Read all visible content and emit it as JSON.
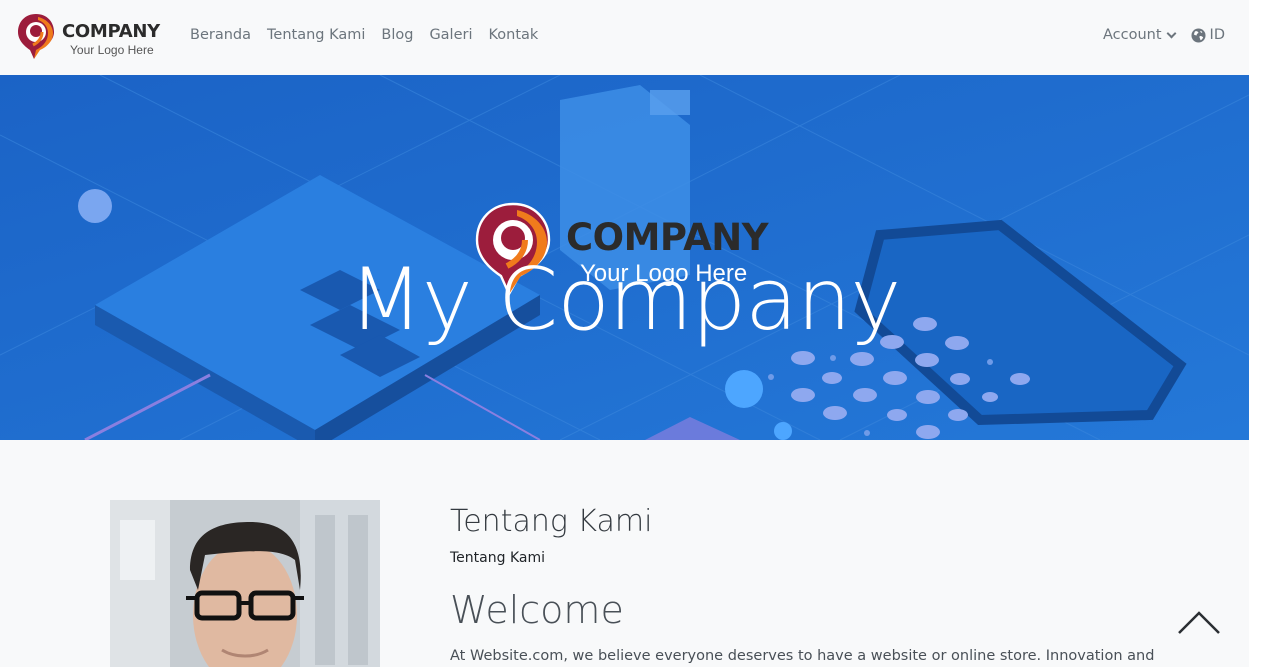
{
  "brand": {
    "name": "COMPANY",
    "tagline": "Your Logo Here"
  },
  "nav": {
    "links": [
      {
        "label": "Beranda"
      },
      {
        "label": "Tentang Kami"
      },
      {
        "label": "Blog"
      },
      {
        "label": "Galeri"
      },
      {
        "label": "Kontak"
      }
    ],
    "account_label": "Account",
    "language_label": "ID",
    "icons": [
      "caret-down-icon",
      "globe-icon"
    ]
  },
  "hero": {
    "logo_name": "COMPANY",
    "logo_tagline": "Your Logo Here",
    "title": "My Company"
  },
  "about": {
    "title": "Tentang Kami",
    "subtitle": "Tentang Kami",
    "welcome": "Welcome",
    "intro": "At Website.com, we believe everyone deserves to have a website or online store. Innovation and"
  },
  "colors": {
    "hero_bg": "#1f6fd1",
    "logo_red": "#9c1d3c",
    "logo_orange": "#f07b1c",
    "nav_text": "#6c757d"
  },
  "scroll_top_icon": "chevron-up-icon"
}
